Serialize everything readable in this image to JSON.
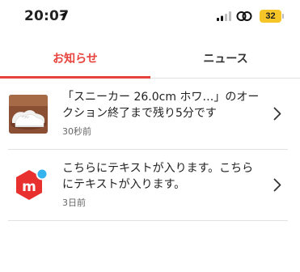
{
  "status_bar": {
    "time": "20:07",
    "battery": "32"
  },
  "tabs": [
    {
      "label": "お知らせ",
      "active": true
    },
    {
      "label": "ニュース",
      "active": false
    }
  ],
  "notifications": [
    {
      "title": "「スニーカー 26.0cm ホワ…」のオークション終了まで残り5分です",
      "time": "30秒前",
      "thumb_icon": "sneaker-photo"
    },
    {
      "title": "こちらにテキストが入ります。こちらにテキストが入ります。",
      "time": "3日前",
      "thumb_icon": "mercari-logo-icon"
    }
  ],
  "colors": {
    "accent": "#e8423c",
    "logo_red": "#e8312f",
    "logo_dot": "#34b3ef",
    "battery": "#f6c528"
  }
}
